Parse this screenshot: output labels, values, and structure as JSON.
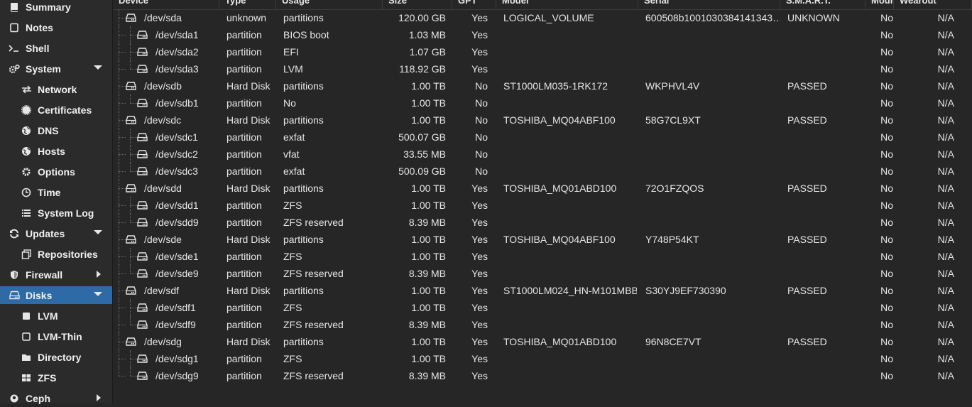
{
  "sidebar": {
    "items": [
      {
        "label": "Summary",
        "icon": "book-icon",
        "indent": false,
        "arrow": ""
      },
      {
        "label": "Notes",
        "icon": "notes-icon",
        "indent": false,
        "arrow": ""
      },
      {
        "label": "Shell",
        "icon": "terminal-icon",
        "indent": false,
        "arrow": ""
      },
      {
        "label": "System",
        "icon": "cogs-icon",
        "indent": false,
        "arrow": "down"
      },
      {
        "label": "Network",
        "icon": "exchange-icon",
        "indent": true,
        "arrow": ""
      },
      {
        "label": "Certificates",
        "icon": "certificate-icon",
        "indent": true,
        "arrow": ""
      },
      {
        "label": "DNS",
        "icon": "globe-icon",
        "indent": true,
        "arrow": ""
      },
      {
        "label": "Hosts",
        "icon": "globe-icon",
        "indent": true,
        "arrow": ""
      },
      {
        "label": "Options",
        "icon": "gear-icon",
        "indent": true,
        "arrow": ""
      },
      {
        "label": "Time",
        "icon": "clock-icon",
        "indent": true,
        "arrow": ""
      },
      {
        "label": "System Log",
        "icon": "list-icon",
        "indent": true,
        "arrow": ""
      },
      {
        "label": "Updates",
        "icon": "refresh-icon",
        "indent": false,
        "arrow": "down"
      },
      {
        "label": "Repositories",
        "icon": "files-icon",
        "indent": true,
        "arrow": ""
      },
      {
        "label": "Firewall",
        "icon": "shield-icon",
        "indent": false,
        "arrow": "right"
      },
      {
        "label": "Disks",
        "icon": "hdd-icon",
        "indent": false,
        "arrow": "down",
        "selected": true
      },
      {
        "label": "LVM",
        "icon": "square-icon",
        "indent": true,
        "arrow": ""
      },
      {
        "label": "LVM-Thin",
        "icon": "square-outline-icon",
        "indent": true,
        "arrow": ""
      },
      {
        "label": "Directory",
        "icon": "folder-icon",
        "indent": true,
        "arrow": ""
      },
      {
        "label": "ZFS",
        "icon": "grid-icon",
        "indent": true,
        "arrow": ""
      },
      {
        "label": "Ceph",
        "icon": "ceph-icon",
        "indent": false,
        "arrow": "right"
      }
    ]
  },
  "table": {
    "columns": [
      "Device",
      "Type",
      "Usage",
      "Size",
      "GPT",
      "Model",
      "Serial",
      "S.M.A.R.T.",
      "Mounted",
      "Wearout"
    ],
    "rows": [
      {
        "device": "/dev/sda",
        "type": "unknown",
        "usage": "partitions",
        "size": "120.00 GB",
        "gpt": "Yes",
        "model": "LOGICAL_VOLUME",
        "serial": "600508b1001030384141343…",
        "smart": "UNKNOWN",
        "mounted": "No",
        "wearout": "N/A",
        "child": false
      },
      {
        "device": "/dev/sda1",
        "type": "partition",
        "usage": "BIOS boot",
        "size": "1.03 MB",
        "gpt": "Yes",
        "model": "",
        "serial": "",
        "smart": "",
        "mounted": "No",
        "wearout": "N/A",
        "child": true
      },
      {
        "device": "/dev/sda2",
        "type": "partition",
        "usage": "EFI",
        "size": "1.07 GB",
        "gpt": "Yes",
        "model": "",
        "serial": "",
        "smart": "",
        "mounted": "No",
        "wearout": "N/A",
        "child": true
      },
      {
        "device": "/dev/sda3",
        "type": "partition",
        "usage": "LVM",
        "size": "118.92 GB",
        "gpt": "Yes",
        "model": "",
        "serial": "",
        "smart": "",
        "mounted": "No",
        "wearout": "N/A",
        "child": true
      },
      {
        "device": "/dev/sdb",
        "type": "Hard Disk",
        "usage": "partitions",
        "size": "1.00 TB",
        "gpt": "No",
        "model": "ST1000LM035-1RK172",
        "serial": "WKPHVL4V",
        "smart": "PASSED",
        "mounted": "No",
        "wearout": "N/A",
        "child": false
      },
      {
        "device": "/dev/sdb1",
        "type": "partition",
        "usage": "No",
        "size": "1.00 TB",
        "gpt": "No",
        "model": "",
        "serial": "",
        "smart": "",
        "mounted": "No",
        "wearout": "N/A",
        "child": true
      },
      {
        "device": "/dev/sdc",
        "type": "Hard Disk",
        "usage": "partitions",
        "size": "1.00 TB",
        "gpt": "No",
        "model": "TOSHIBA_MQ04ABF100",
        "serial": "58G7CL9XT",
        "smart": "PASSED",
        "mounted": "No",
        "wearout": "N/A",
        "child": false
      },
      {
        "device": "/dev/sdc1",
        "type": "partition",
        "usage": "exfat",
        "size": "500.07 GB",
        "gpt": "No",
        "model": "",
        "serial": "",
        "smart": "",
        "mounted": "No",
        "wearout": "N/A",
        "child": true
      },
      {
        "device": "/dev/sdc2",
        "type": "partition",
        "usage": "vfat",
        "size": "33.55 MB",
        "gpt": "No",
        "model": "",
        "serial": "",
        "smart": "",
        "mounted": "No",
        "wearout": "N/A",
        "child": true
      },
      {
        "device": "/dev/sdc3",
        "type": "partition",
        "usage": "exfat",
        "size": "500.09 GB",
        "gpt": "No",
        "model": "",
        "serial": "",
        "smart": "",
        "mounted": "No",
        "wearout": "N/A",
        "child": true
      },
      {
        "device": "/dev/sdd",
        "type": "Hard Disk",
        "usage": "partitions",
        "size": "1.00 TB",
        "gpt": "Yes",
        "model": "TOSHIBA_MQ01ABD100",
        "serial": "72O1FZQOS",
        "smart": "PASSED",
        "mounted": "No",
        "wearout": "N/A",
        "child": false
      },
      {
        "device": "/dev/sdd1",
        "type": "partition",
        "usage": "ZFS",
        "size": "1.00 TB",
        "gpt": "Yes",
        "model": "",
        "serial": "",
        "smart": "",
        "mounted": "No",
        "wearout": "N/A",
        "child": true
      },
      {
        "device": "/dev/sdd9",
        "type": "partition",
        "usage": "ZFS reserved",
        "size": "8.39 MB",
        "gpt": "Yes",
        "model": "",
        "serial": "",
        "smart": "",
        "mounted": "No",
        "wearout": "N/A",
        "child": true
      },
      {
        "device": "/dev/sde",
        "type": "Hard Disk",
        "usage": "partitions",
        "size": "1.00 TB",
        "gpt": "Yes",
        "model": "TOSHIBA_MQ04ABF100",
        "serial": "Y748P54KT",
        "smart": "PASSED",
        "mounted": "No",
        "wearout": "N/A",
        "child": false
      },
      {
        "device": "/dev/sde1",
        "type": "partition",
        "usage": "ZFS",
        "size": "1.00 TB",
        "gpt": "Yes",
        "model": "",
        "serial": "",
        "smart": "",
        "mounted": "No",
        "wearout": "N/A",
        "child": true
      },
      {
        "device": "/dev/sde9",
        "type": "partition",
        "usage": "ZFS reserved",
        "size": "8.39 MB",
        "gpt": "Yes",
        "model": "",
        "serial": "",
        "smart": "",
        "mounted": "No",
        "wearout": "N/A",
        "child": true
      },
      {
        "device": "/dev/sdf",
        "type": "Hard Disk",
        "usage": "partitions",
        "size": "1.00 TB",
        "gpt": "Yes",
        "model": "ST1000LM024_HN-M101MBB",
        "serial": "S30YJ9EF730390",
        "smart": "PASSED",
        "mounted": "No",
        "wearout": "N/A",
        "child": false
      },
      {
        "device": "/dev/sdf1",
        "type": "partition",
        "usage": "ZFS",
        "size": "1.00 TB",
        "gpt": "Yes",
        "model": "",
        "serial": "",
        "smart": "",
        "mounted": "No",
        "wearout": "N/A",
        "child": true
      },
      {
        "device": "/dev/sdf9",
        "type": "partition",
        "usage": "ZFS reserved",
        "size": "8.39 MB",
        "gpt": "Yes",
        "model": "",
        "serial": "",
        "smart": "",
        "mounted": "No",
        "wearout": "N/A",
        "child": true
      },
      {
        "device": "/dev/sdg",
        "type": "Hard Disk",
        "usage": "partitions",
        "size": "1.00 TB",
        "gpt": "Yes",
        "model": "TOSHIBA_MQ01ABD100",
        "serial": "96N8CE7VT",
        "smart": "PASSED",
        "mounted": "No",
        "wearout": "N/A",
        "child": false
      },
      {
        "device": "/dev/sdg1",
        "type": "partition",
        "usage": "ZFS",
        "size": "1.00 TB",
        "gpt": "Yes",
        "model": "",
        "serial": "",
        "smart": "",
        "mounted": "No",
        "wearout": "N/A",
        "child": true
      },
      {
        "device": "/dev/sdg9",
        "type": "partition",
        "usage": "ZFS reserved",
        "size": "8.39 MB",
        "gpt": "Yes",
        "model": "",
        "serial": "",
        "smart": "",
        "mounted": "No",
        "wearout": "N/A",
        "child": true
      }
    ]
  },
  "colors": {
    "selected": "#2d6aa6",
    "background": "#262626",
    "sidebar": "#2b2b2b"
  }
}
